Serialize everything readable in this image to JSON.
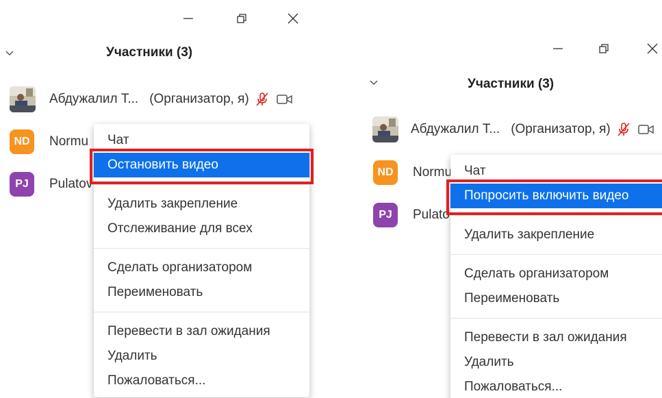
{
  "panels": [
    {
      "title": "Участники (3)",
      "participants": [
        {
          "initials": "",
          "name": "Абдужалил Т...",
          "role": "(Организатор, я)"
        },
        {
          "initials": "ND",
          "name": "Normu",
          "role": ""
        },
        {
          "initials": "PJ",
          "name": "Pulatov",
          "role": ""
        }
      ],
      "menu": {
        "items": [
          "Чат",
          "Остановить видео",
          "Удалить закрепление",
          "Отслеживание для всех",
          "Сделать организатором",
          "Переименовать",
          "Перевести в зал ожидания",
          "Удалить",
          "Пожаловаться..."
        ]
      }
    },
    {
      "title": "Участники (3)",
      "participants": [
        {
          "initials": "",
          "name": "Абдужалил Т...",
          "role": "(Организатор, я)"
        },
        {
          "initials": "ND",
          "name": "Normu",
          "role": ""
        },
        {
          "initials": "PJ",
          "name": "Pulato",
          "role": ""
        }
      ],
      "menu": {
        "items": [
          "Чат",
          "Попросить включить видео",
          "Удалить закрепление",
          "Сделать организатором",
          "Переименовать",
          "Перевести в зал ожидания",
          "Удалить",
          "Пожаловаться..."
        ]
      }
    }
  ],
  "colors": {
    "selected_bg": "#0e71eb",
    "highlight_border": "#e02020",
    "avatar_nd": "#f7931e",
    "avatar_pj": "#8e44ad",
    "mic_muted": "#e02020"
  },
  "icons": {
    "window": [
      "minimize-icon",
      "restore-icon",
      "close-icon"
    ],
    "panel": [
      "chevron-down-icon"
    ],
    "participant": [
      "mic-muted-icon",
      "video-camera-icon"
    ]
  }
}
